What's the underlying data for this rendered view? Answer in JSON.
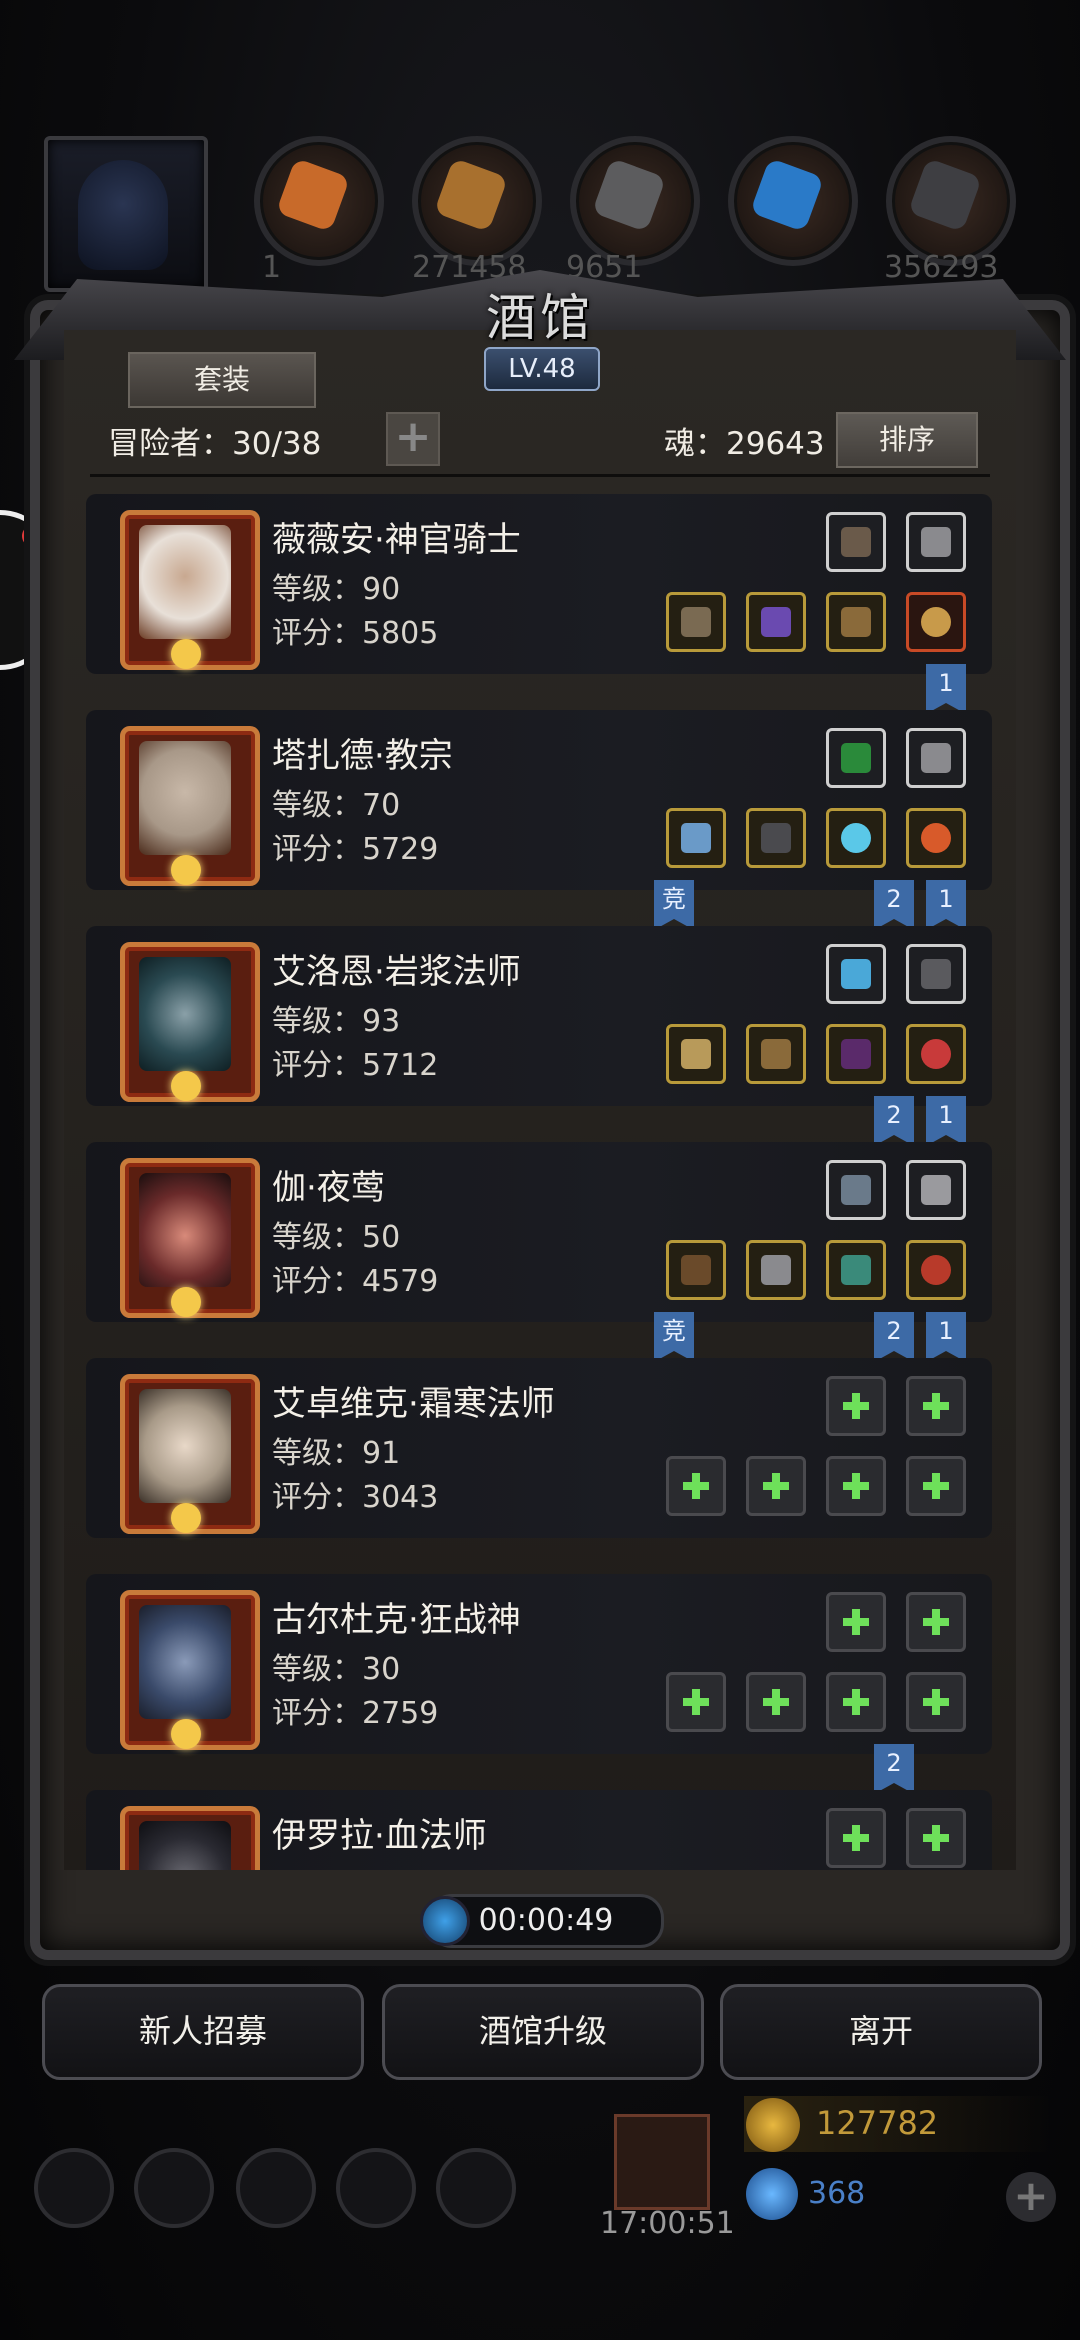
{
  "resources_top": [
    "1",
    "271458",
    "9651",
    "",
    "356293"
  ],
  "tavern": {
    "title": "酒馆",
    "level": "LV.48",
    "set_label": "套装",
    "adventurers_label": "冒险者：30/38",
    "soul_label": "魂：29643",
    "sort_label": "排序"
  },
  "heroes": [
    {
      "name": "薇薇安·神官骑士",
      "level": "等级：90",
      "score": "评分：5805",
      "flags": [
        "",
        "1"
      ]
    },
    {
      "name": "塔扎德·教宗",
      "level": "等级：70",
      "score": "评分：5729",
      "flags": [
        "竞",
        "2",
        "1"
      ]
    },
    {
      "name": "艾洛恩·岩浆法师",
      "level": "等级：93",
      "score": "评分：5712",
      "flags": [
        "2",
        "1"
      ]
    },
    {
      "name": "伽·夜莺",
      "level": "等级：50",
      "score": "评分：4579",
      "flags": [
        "竞",
        "2",
        "1"
      ]
    },
    {
      "name": "艾卓维克·霜寒法师",
      "level": "等级：91",
      "score": "评分：3043",
      "flags": []
    },
    {
      "name": "古尔杜克·狂战神",
      "level": "等级：30",
      "score": "评分：2759",
      "flags": [
        "2"
      ]
    },
    {
      "name": "伊罗拉·血法师",
      "level": "",
      "score": "",
      "flags": []
    }
  ],
  "timer": "00:00:49",
  "buttons": {
    "recruit": "新人招募",
    "upgrade": "酒馆升级",
    "leave": "离开"
  },
  "bottom": {
    "gift_timer": "17:00:51",
    "gold": "127782",
    "gems": "368"
  },
  "side_text": "技"
}
